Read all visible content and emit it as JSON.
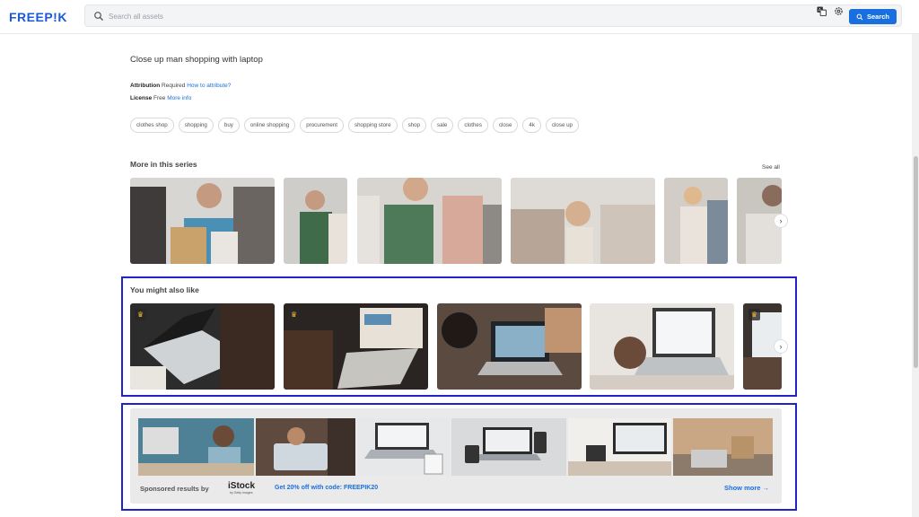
{
  "header": {
    "logo": "FREEP!K",
    "search_placeholder": "Search all assets",
    "search_button": "Search",
    "icons": [
      "search-icon",
      "translate-icon",
      "settings-icon"
    ]
  },
  "asset": {
    "title": "Close up man shopping with laptop",
    "attribution_label": "Attribution",
    "attribution_value": "Required",
    "attribution_link": "How to attribute?",
    "license_label": "License",
    "license_value": "Free",
    "license_link": "More info"
  },
  "tags": [
    "clothes shop",
    "shopping",
    "buy",
    "online shopping",
    "procurement",
    "shopping store",
    "shop",
    "sale",
    "clothes",
    "close",
    "4k",
    "close up"
  ],
  "series": {
    "title": "More in this series",
    "see_all": "See all"
  },
  "also_like": {
    "title": "You might also like"
  },
  "sponsored": {
    "label": "Sponsored results by",
    "brand": "iStock",
    "brand_sub": "by Getty Images",
    "promo": "Get 20% off with code: FREEPIK20",
    "show_more": "Show more →"
  },
  "colors": {
    "brand": "#1a5ad9",
    "accent": "#1a6fe0",
    "highlight": "#1f23c8"
  }
}
